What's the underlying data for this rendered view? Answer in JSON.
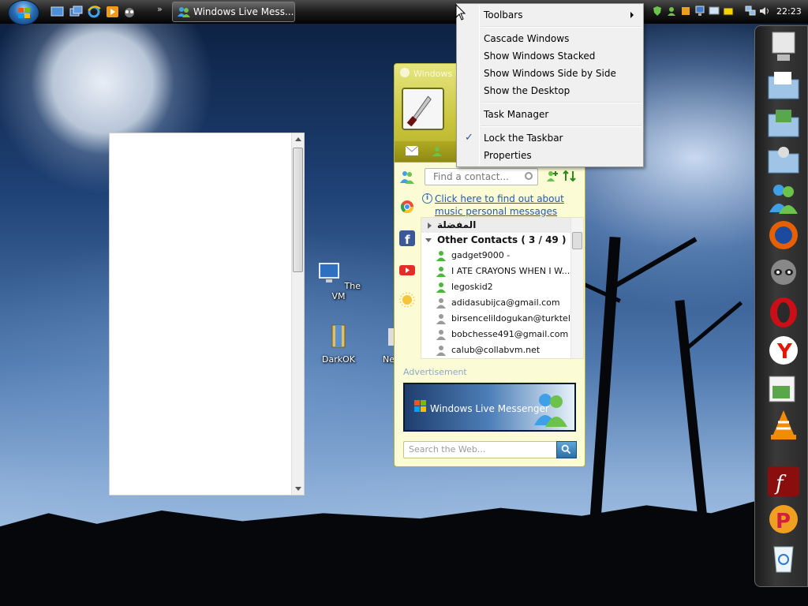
{
  "taskbar": {
    "task_label": "Windows Live Mess...",
    "clock": "22:23",
    "overflow": "»"
  },
  "context_menu": {
    "toolbars": "Toolbars",
    "cascade": "Cascade Windows",
    "stacked": "Show Windows Stacked",
    "side_by_side": "Show Windows Side by Side",
    "show_desktop": "Show the Desktop",
    "task_manager": "Task Manager",
    "lock_taskbar": "Lock the Taskbar",
    "properties": "Properties",
    "check": "✓"
  },
  "desktop_icons": [
    {
      "label": "The VM"
    },
    {
      "label": "DarkOK"
    },
    {
      "label": "Ne"
    }
  ],
  "messenger": {
    "title": "Windows Live",
    "search_placeholder": "Find a contact...",
    "info_link": "Click here to find out about music personal messages",
    "favorites_group": "المفضلة",
    "other_group": "Other Contacts ( 3 / 49 )",
    "contacts": [
      {
        "name": "gadget9000 -",
        "online": true
      },
      {
        "name": "I ATE CRAYONS WHEN I W...",
        "online": true
      },
      {
        "name": "legoskid2",
        "online": true
      },
      {
        "name": "adidasubijca@gmail.com",
        "online": false
      },
      {
        "name": "birsencelildogukan@turktel...",
        "online": false
      },
      {
        "name": "bobchesse491@gmail.com",
        "online": false
      },
      {
        "name": "calub@collabvm.net",
        "online": false
      }
    ],
    "ad_label": "Advertisement",
    "ad_text": "Windows Live Messenger",
    "web_search_placeholder": "Search the Web..."
  },
  "colors": {
    "messenger_accent": "#c8c43a",
    "link": "#2357b8"
  }
}
